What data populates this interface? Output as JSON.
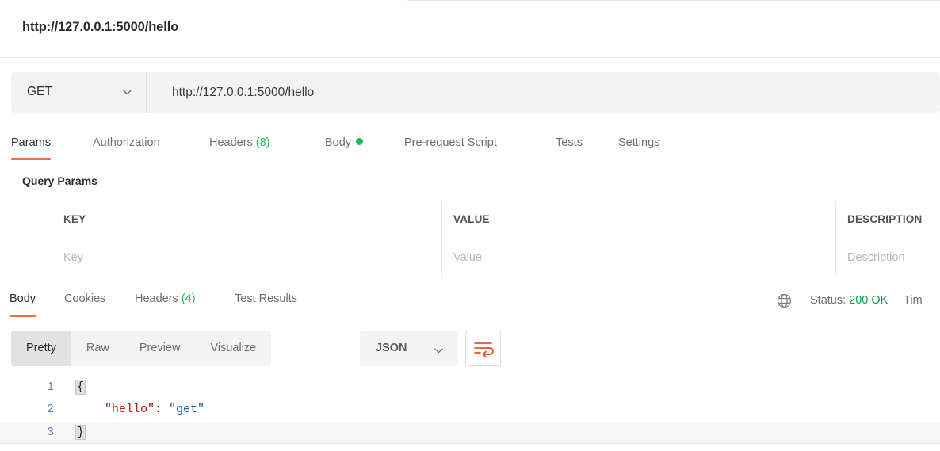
{
  "request": {
    "title": "http://127.0.0.1:5000/hello",
    "method": "GET",
    "url": "http://127.0.0.1:5000/hello",
    "method_chevron_icon": "chevron-down-icon"
  },
  "request_tabs": [
    {
      "label": "Params",
      "active": true,
      "badge": "",
      "dot": false
    },
    {
      "label": "Authorization",
      "active": false,
      "badge": "",
      "dot": false
    },
    {
      "label": "Headers",
      "active": false,
      "badge": "(8)",
      "dot": false
    },
    {
      "label": "Body",
      "active": false,
      "badge": "",
      "dot": true
    },
    {
      "label": "Pre-request Script",
      "active": false,
      "badge": "",
      "dot": false
    },
    {
      "label": "Tests",
      "active": false,
      "badge": "",
      "dot": false
    },
    {
      "label": "Settings",
      "active": false,
      "badge": "",
      "dot": false
    }
  ],
  "query_params": {
    "heading": "Query Params",
    "columns": [
      "",
      "KEY",
      "VALUE",
      "DESCRIPTION"
    ],
    "rows": [
      {
        "check": "",
        "key": "Key",
        "value": "Value",
        "description": "Description"
      }
    ]
  },
  "response_tabs": [
    {
      "label": "Body",
      "active": true,
      "badge": ""
    },
    {
      "label": "Cookies",
      "active": false,
      "badge": ""
    },
    {
      "label": "Headers",
      "active": false,
      "badge": "(4)"
    },
    {
      "label": "Test Results",
      "active": false,
      "badge": ""
    }
  ],
  "response_status": {
    "globe_icon": "globe-icon",
    "status_prefix": "Status:",
    "status_code": "200 OK",
    "time_label": "Tim"
  },
  "response_toolbar": {
    "views": [
      {
        "label": "Pretty",
        "active": true
      },
      {
        "label": "Raw",
        "active": false
      },
      {
        "label": "Preview",
        "active": false
      },
      {
        "label": "Visualize",
        "active": false
      }
    ],
    "format": "JSON",
    "format_chevron_icon": "chevron-down-icon",
    "wrap_icon": "word-wrap-icon"
  },
  "response_body": {
    "lines": [
      {
        "num": "1",
        "open_brace": "{"
      },
      {
        "num": "2",
        "indent": "    ",
        "key": "\"hello\"",
        "colon": ": ",
        "value": "\"get\""
      },
      {
        "num": "3",
        "close_brace": "}"
      }
    ]
  },
  "colors": {
    "accent": "#f26b3a",
    "status_green": "#0aa050",
    "body_dot_green": "#20b85c",
    "json_key": "#a02020",
    "json_string": "#1f5fb0",
    "line_number": "#5b86b3"
  }
}
